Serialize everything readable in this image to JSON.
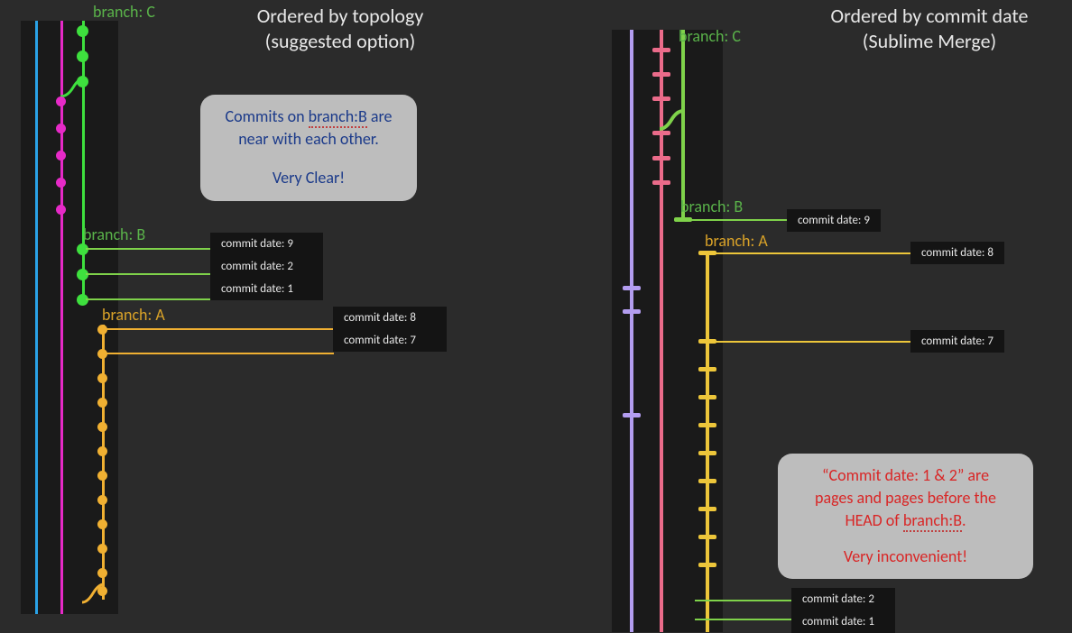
{
  "left": {
    "title_line1": "Ordered by topology",
    "title_line2": "(suggested option)",
    "branch_c": "branch: C",
    "branch_b": "branch: B",
    "branch_a": "branch: A",
    "callout_line1a": "Commits on ",
    "callout_line1b": "branch:B",
    "callout_line1c": " are",
    "callout_line2": "near with each other.",
    "callout_line3": "Very Clear!",
    "commit9": "commit date: 9",
    "commit2": "commit date: 2",
    "commit1": "commit date: 1",
    "commit8": "commit date: 8",
    "commit7": "commit date: 7"
  },
  "right": {
    "title_line1": "Ordered by commit date",
    "title_line2": "(Sublime Merge)",
    "branch_c": "branch: C",
    "branch_b": "branch: B",
    "branch_a": "branch: A",
    "commit9": "commit date: 9",
    "commit8": "commit date: 8",
    "commit7": "commit date: 7",
    "commit2": "commit date: 2",
    "commit1": "commit date: 1",
    "callout_line1": "“Commit date: 1 & 2” are",
    "callout_line2": "pages and pages before the",
    "callout_line3a": "HEAD of ",
    "callout_line3b": "branch:B",
    "callout_line3c": ".",
    "callout_line4": "Very inconvenient!"
  },
  "colors": {
    "blue": "#2aa2e6",
    "magenta": "#e62ac7",
    "green": "#3ee03e",
    "orange": "#f0b032",
    "purple": "#b39df0",
    "pink": "#eb6b8a",
    "yellow": "#edc63a",
    "green2": "#7fd24a",
    "branch_green": "#5ab34a",
    "branch_orange": "#d9a228"
  }
}
